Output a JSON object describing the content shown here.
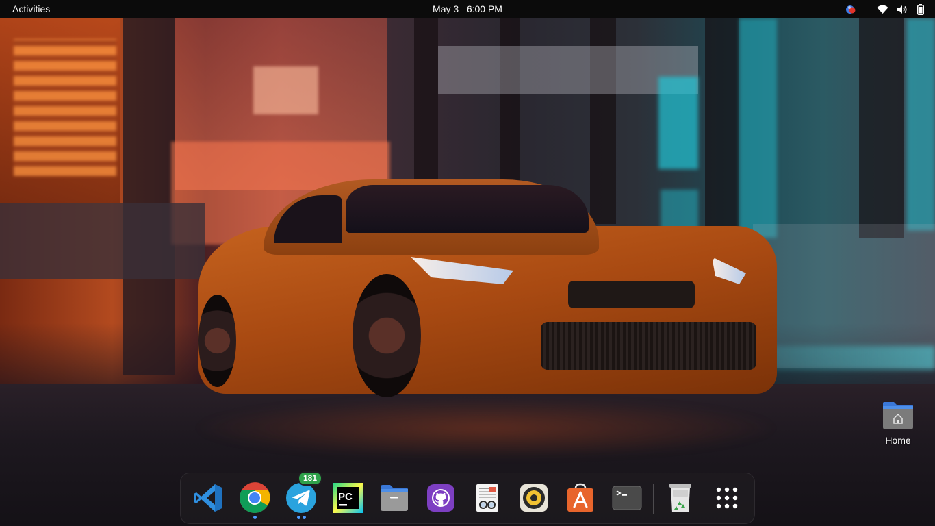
{
  "topbar": {
    "activities_label": "Activities",
    "date": "May 3",
    "time": "6:00 PM",
    "tray": [
      "notification-icon",
      "wifi-icon",
      "volume-icon",
      "battery-icon"
    ]
  },
  "desktop_icons": [
    {
      "label": "Home",
      "icon": "home-folder-icon"
    }
  ],
  "dock": {
    "apps": [
      {
        "name": "Visual Studio Code",
        "icon": "vscode-icon",
        "running": false
      },
      {
        "name": "Google Chrome",
        "icon": "chrome-icon",
        "running": true
      },
      {
        "name": "Telegram",
        "icon": "telegram-icon",
        "running": true,
        "badge": "181"
      },
      {
        "name": "PyCharm",
        "icon": "pycharm-icon",
        "running": false
      },
      {
        "name": "Files",
        "icon": "files-icon",
        "running": false
      },
      {
        "name": "GitHub Desktop",
        "icon": "github-icon",
        "running": false
      },
      {
        "name": "Document Viewer",
        "icon": "document-viewer-icon",
        "running": false
      },
      {
        "name": "Rhythmbox",
        "icon": "rhythmbox-icon",
        "running": false
      },
      {
        "name": "Ubuntu Software",
        "icon": "app-store-icon",
        "running": false
      },
      {
        "name": "Terminal",
        "icon": "terminal-icon",
        "running": false
      },
      {
        "name": "Trash",
        "icon": "trash-icon",
        "running": false
      },
      {
        "name": "Show Applications",
        "icon": "app-grid-icon",
        "running": false
      }
    ]
  },
  "colors": {
    "topbar_bg": "#0b0b0b",
    "running_indicator": "#4e9cff",
    "badge_bg": "#2fa14a"
  }
}
